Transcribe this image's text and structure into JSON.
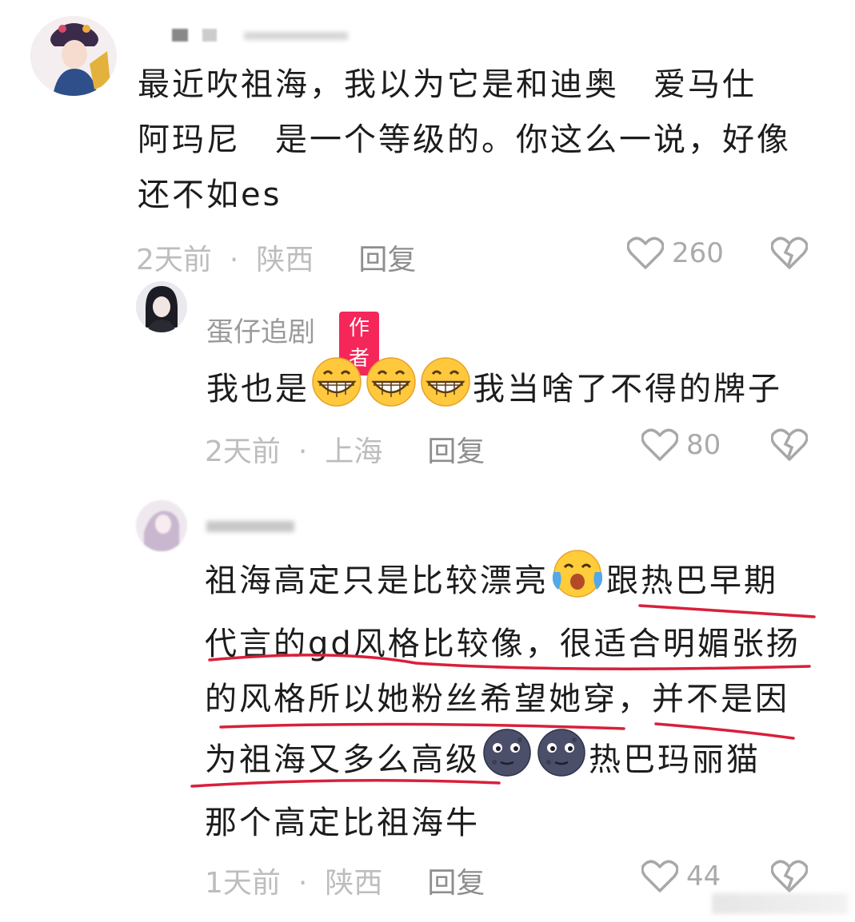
{
  "comments": [
    {
      "username": "",
      "lines": [
        "最近吹祖海，我以为它是和迪奥　爱马仕",
        "阿玛尼　是一个等级的。你这么一说，好像",
        "还不如es"
      ],
      "time": "2天前",
      "location": "陕西",
      "reply": "回复",
      "likes": "260"
    },
    {
      "username": "蛋仔追剧",
      "badge": "作者",
      "line_before": "我也是",
      "line_after": "我当啥了不得的牌子",
      "emojis": [
        "grin-emoji",
        "grin-emoji",
        "grin-emoji"
      ],
      "time": "2天前",
      "location": "上海",
      "reply": "回复",
      "likes": "80"
    },
    {
      "username": "",
      "line1_before": "祖海高定只是比较漂亮",
      "line1_after": "跟热巴早期",
      "line2": "代言的gd风格比较像，很适合明媚张扬",
      "line3": "的风格所以她粉丝希望她穿，并不是因",
      "line4_before": "为祖海又多么高级",
      "line4_after": "热巴玛丽猫",
      "line5": "那个高定比祖海牛",
      "emojis": [
        "tear-laugh-emoji",
        "moon-face-emoji",
        "moon-face-emoji"
      ],
      "time": "1天前",
      "location": "陕西",
      "reply": "回复",
      "likes": "44"
    }
  ],
  "colors": {
    "badge": "#f5265a",
    "annotation": "#d8203a",
    "meta": "#bdbdbd"
  }
}
